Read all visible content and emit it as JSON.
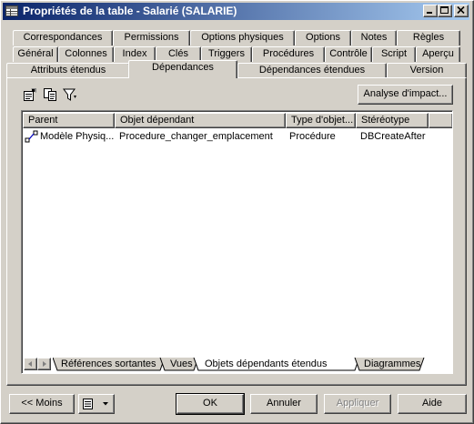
{
  "window": {
    "title": "Propriétés de la table - Salarié (SALARIE)"
  },
  "tabs": {
    "row1": [
      "Correspondances",
      "Permissions",
      "Options physiques",
      "Options",
      "Notes",
      "Règles"
    ],
    "row2": [
      "Général",
      "Colonnes",
      "Index",
      "Clés",
      "Triggers",
      "Procédures",
      "Contrôle",
      "Script",
      "Aperçu"
    ],
    "row3": [
      "Attributs étendus",
      "Dépendances",
      "Dépendances étendues",
      "Version"
    ],
    "active": "Dépendances"
  },
  "toolbar": {
    "icons": [
      "properties-icon",
      "copy-icon",
      "filter-icon"
    ],
    "impact_button": "Analyse d'impact..."
  },
  "list": {
    "columns": [
      "Parent",
      "Objet dépendant",
      "Type d'objet...",
      "Stéréotype"
    ],
    "rows": [
      [
        "Modèle Physiq...",
        "Procedure_changer_emplacement",
        "Procédure",
        "DBCreateAfter"
      ]
    ],
    "row_icon": "model-link-icon"
  },
  "subtabs": {
    "items": [
      "Références sortantes",
      "Vues",
      "Objets dépendants étendus",
      "Diagrammes"
    ],
    "active": "Objets dépendants étendus"
  },
  "footer": {
    "less_button": "<< Moins",
    "ok": "OK",
    "cancel": "Annuler",
    "apply": "Appliquer",
    "help": "Aide"
  }
}
